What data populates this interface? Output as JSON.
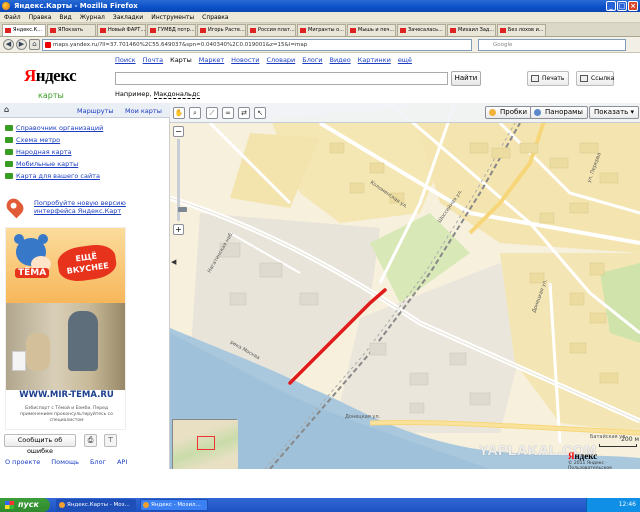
{
  "window": {
    "title": "Яндекс.Карты - Mozilla Firefox"
  },
  "menu": [
    "Файл",
    "Правка",
    "Вид",
    "Журнал",
    "Закладки",
    "Инструменты",
    "Справка"
  ],
  "tabs": [
    "Яндекс.К...",
    "ЯПокзать",
    "Новый ФАРТ...",
    "ГУМВД потр...",
    "Игорь Расте...",
    "Россия плат...",
    "Мигранты о...",
    "Мышь и печ...",
    "Зачесалась...",
    "Михаил Зад...",
    "Без лохов и..."
  ],
  "nav": {
    "url": "maps.yandex.ru/?ll=37.701460%2C55.649037&spn=0.040340%2C0.019001&z=15&l=map",
    "search_placeholder": "Google"
  },
  "header": {
    "logo_main": "Яндекс",
    "logo_sub": "карты",
    "nav_links": [
      "Поиск",
      "Почта",
      "Карты",
      "Маркет",
      "Новости",
      "Словари",
      "Блоги",
      "Видео",
      "Картинки",
      "ещё"
    ],
    "current": "Карты",
    "find_label": "Найти",
    "example_prefix": "Например,",
    "example_link": "Макдональдс",
    "print_label": "Печать",
    "link_label": "Ссылка"
  },
  "sidebar": {
    "tab_routes": "Маршруты",
    "tab_mymaps": "Мои карты",
    "links": [
      "Справочник организаций",
      "Схема метро",
      "Народная карта",
      "Мобильные карты",
      "Карта для вашего сайта"
    ],
    "update_note": "Попробуйте новую версию интерфейса Яндекс.Карт",
    "ad": {
      "brand": "ТЁМА",
      "slogan": "ЕЩЁ ВКУСНЕЕ",
      "url": "WWW.MIR-TEMA.RU",
      "fine": "Бэбиспорт с Тёмой и Бэмби. Перед применением проконсультируйтесь со специалистом"
    },
    "report_label": "Сообщить об ошибке",
    "footer_links": [
      "О проекте",
      "Помощь",
      "Блог",
      "API"
    ]
  },
  "map": {
    "traffic_label": "Пробки",
    "panorama_label": "Панорамы",
    "show_label": "Показать",
    "scale_label": "200 м",
    "yandex_label": "Яндекс",
    "copyright": "© 2011 Яндекс · Пользовательское соглашение",
    "watermark": "YAPLAKAL.COM",
    "streets": [
      "Нагатинская наб.",
      "Коломенская ул.",
      "Шоссейная ул.",
      "Батайская ул.",
      "Донецкая ул.",
      "Братиславская ул.",
      "Люблинская ул.",
      "Перерва ул.",
      "Ставропольская ул.",
      "река Москва"
    ],
    "highlight_color": "#e01b1b"
  },
  "taskbar": {
    "start": "пуск",
    "items": [
      "Яндекс.Карты - Моз...",
      "Яндекс - Мозил..."
    ],
    "time": "12:46"
  }
}
